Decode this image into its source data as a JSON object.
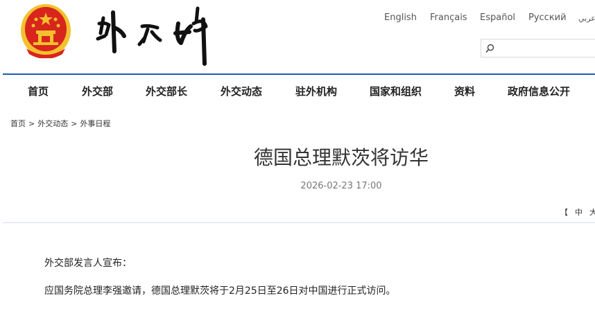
{
  "header": {
    "languages": [
      "English",
      "Français",
      "Español",
      "Русский",
      "عربي"
    ],
    "search": {
      "value": "",
      "placeholder": ""
    }
  },
  "nav": {
    "items": [
      "首页",
      "外交部",
      "外交部长",
      "外交动态",
      "驻外机构",
      "国家和组织",
      "资料",
      "政府信息公开"
    ]
  },
  "breadcrumb": {
    "items": [
      "首页",
      "外交动态",
      "外事日程"
    ],
    "separator": ">"
  },
  "article": {
    "title": "德国总理默茨将访华",
    "date": "2026-02-23 17:00",
    "font_size_controls": [
      "【",
      "中",
      "大"
    ],
    "paragraphs": [
      "外交部发言人宣布：",
      "应国务院总理李强邀请，德国总理默茨将于2月25日至26日对中国进行正式访问。"
    ]
  },
  "colors": {
    "nav_border": "#1e5aa8",
    "emblem_red": "#d8261c",
    "emblem_gold": "#f3c12e"
  }
}
